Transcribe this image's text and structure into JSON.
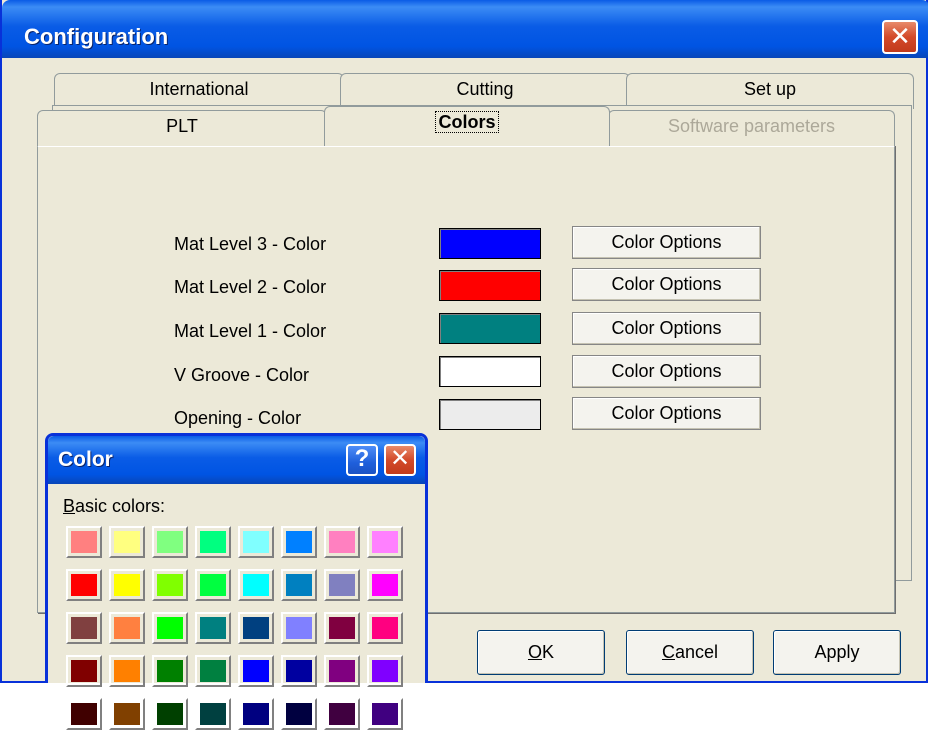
{
  "window": {
    "title": "Configuration",
    "close_label": "✕"
  },
  "tabs": {
    "back_row": [
      "International",
      "Cutting",
      "Set up"
    ],
    "front_row": [
      "PLT",
      "Colors",
      "Software parameters"
    ]
  },
  "colors_panel": {
    "rows": [
      {
        "label": "Mat Level 3 - Color",
        "swatch": "#0000ff",
        "button": "Color Options"
      },
      {
        "label": "Mat Level 2 - Color",
        "swatch": "#ff0000",
        "button": "Color Options"
      },
      {
        "label": "Mat Level 1 - Color",
        "swatch": "#008080",
        "button": "Color Options"
      },
      {
        "label": "V Groove - Color",
        "swatch": "#ffffff",
        "button": "Color Options"
      },
      {
        "label": "Opening - Color",
        "swatch": "#ececec",
        "button": "Color Options"
      }
    ]
  },
  "dialog_buttons": {
    "ok_mnemonic": "O",
    "ok_rest": "K",
    "cancel_mnemonic": "C",
    "cancel_rest": "ancel",
    "apply_mnemonic": "",
    "apply_rest": "Apply"
  },
  "color_dialog": {
    "title": "Color",
    "help_label": "?",
    "close_label": "✕",
    "basic_colors_mnemonic": "B",
    "basic_colors_rest": "asic colors:",
    "basic_colors": [
      [
        "#ff8080",
        "#ffff80",
        "#80ff80",
        "#00ff80",
        "#80ffff",
        "#0080ff",
        "#ff80c0",
        "#ff80ff"
      ],
      [
        "#ff0000",
        "#ffff00",
        "#80ff00",
        "#00ff40",
        "#00ffff",
        "#0080c0",
        "#8080c0",
        "#ff00ff"
      ],
      [
        "#804040",
        "#ff8040",
        "#00ff00",
        "#008080",
        "#004080",
        "#8080ff",
        "#800040",
        "#ff0080"
      ],
      [
        "#800000",
        "#ff8000",
        "#008000",
        "#008040",
        "#0000ff",
        "#0000a0",
        "#800080",
        "#8000ff"
      ],
      [
        "#400000",
        "#804000",
        "#004000",
        "#004040",
        "#000080",
        "#000040",
        "#400040",
        "#400080"
      ]
    ]
  }
}
